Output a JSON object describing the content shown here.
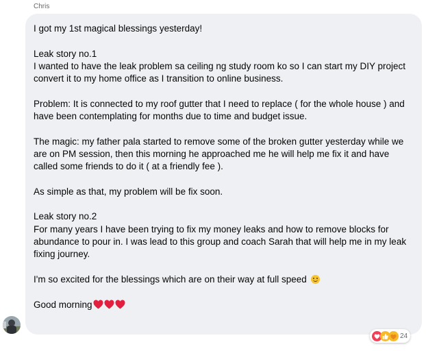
{
  "message": {
    "sender": "Chris",
    "paragraphs": [
      "I got my 1st magical blessings yesterday!",
      "Leak story no.1\nI wanted to have the leak problem sa ceiling ng study room ko so I can start my DIY project convert it to my home office as I transition to online business.",
      "Problem: It is connected to my roof gutter that I need to replace ( for the whole house ) and have been contemplating for months due to time and budget issue.",
      "The magic: my father pala started to remove some of the broken gutter yesterday while we are on PM session, then this morning he approached me he will help me fix it and have called some friends to do it ( at a friendly fee ).",
      "As simple as that, my problem will be fix soon.",
      "Leak story no.2\nFor many years I have been trying to fix my money leaks and how to remove blocks for abundance to pour in. I was lead to this group and coach Sarah that will help me in my leak fixing journey.",
      "I'm so excited for the blessings which are on their way at full speed",
      "Good morning"
    ],
    "reactions": {
      "icons": [
        "heart-reaction",
        "like-reaction",
        "care-reaction"
      ],
      "count": "24"
    }
  },
  "colors": {
    "bubble": "#eef0f3",
    "text": "#050505",
    "meta_text": "#65676b",
    "heart": "#e41e3f",
    "like": "#f7b928"
  }
}
